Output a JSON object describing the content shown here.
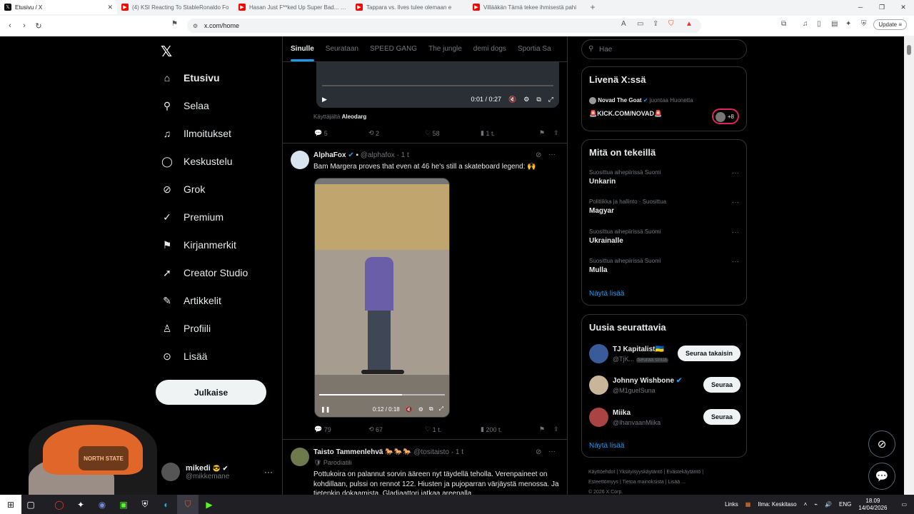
{
  "browser": {
    "tabs": [
      {
        "title": "Etusivu / X",
        "type": "x",
        "active": true
      },
      {
        "title": "(4) KSI Reacting To StableRonaldo Fo",
        "type": "yt"
      },
      {
        "title": "Hasan Just F**ked Up Super Bad... - Y",
        "type": "yt"
      },
      {
        "title": "Tappara vs. Ilves tulee olemaan e",
        "type": "yt"
      },
      {
        "title": "Villääkän Tämä tekee ihmisestä pahi",
        "type": "yt"
      }
    ],
    "new_tab": "+",
    "url": "x.com/home",
    "update_label": "Update"
  },
  "nav": {
    "logo": "X",
    "items": [
      {
        "label": "Etusivu",
        "icon": "home-icon",
        "glyph": "⌂"
      },
      {
        "label": "Selaa",
        "icon": "search-icon",
        "glyph": "⚲"
      },
      {
        "label": "Ilmoitukset",
        "icon": "bell-icon",
        "glyph": "♫"
      },
      {
        "label": "Keskustelu",
        "icon": "chat-icon",
        "glyph": "◯"
      },
      {
        "label": "Grok",
        "icon": "grok-icon",
        "glyph": "⊘"
      },
      {
        "label": "Premium",
        "icon": "premium-icon",
        "glyph": "✓"
      },
      {
        "label": "Kirjanmerkit",
        "icon": "bookmark-icon",
        "glyph": "⚑"
      },
      {
        "label": "Creator Studio",
        "icon": "rocket-icon",
        "glyph": "➚"
      },
      {
        "label": "Artikkelit",
        "icon": "article-icon",
        "glyph": "✎"
      },
      {
        "label": "Profiili",
        "icon": "profile-icon",
        "glyph": "♙"
      },
      {
        "label": "Lisää",
        "icon": "more-icon",
        "glyph": "⊙"
      }
    ],
    "post_label": "Julkaise",
    "account": {
      "name": "mikedi",
      "handle": "@mikkemane",
      "badges": "😎 ✔"
    },
    "account_more": "···"
  },
  "feed": {
    "tabs": [
      "Sinulle",
      "Seurataan",
      "SPEED GANG",
      "The jungle",
      "demi dogs",
      "Sportia Sa"
    ],
    "top_video": {
      "time": "0:01 / 0:27"
    },
    "top_credit_prefix": "Käyttäjältä",
    "top_credit_user": "Aleodarg",
    "top_actions": {
      "replies": "5",
      "reposts": "2",
      "likes": "58",
      "views": "1 t."
    },
    "tweets": [
      {
        "name": "AlphaFox",
        "handle": "@alphafox · 1 t",
        "text": "Bam Margera proves that even at 46 he's still a skateboard legend: 🙌",
        "video_time": "0:12 / 0:18",
        "video_progress": 0.66,
        "actions": {
          "replies": "79",
          "reposts": "67",
          "likes": "1 t.",
          "views": "200 t."
        }
      },
      {
        "name": "Taisto Tammenlehvä",
        "name_emoji": "🐎🐎🐎",
        "handle": "@tositaisto · 1 t",
        "tag": "🛡 Parodiatili",
        "text": "Pottukoira on palannut sorvin ääreen nyt täydellä teholla. Verenpaineet on kohdillaan, pulssi on rennot 122. Hiusten ja pujoparran värjäystä menossa. Ja tietenkin dokaamista. Gladiaattori jatkaa areenalla"
      }
    ]
  },
  "sidebar": {
    "search_placeholder": "Hae",
    "live": {
      "title": "Livenä X:ssä",
      "host": "Novad The Goat",
      "host_action": "juontaa Huonetta",
      "stream": "🚨KICK.COM/NOVAD🚨",
      "listeners": "+8"
    },
    "trends": {
      "title": "Mitä on tekeillä",
      "items": [
        {
          "context": "Suosittua aihepiirissä Suomi",
          "name": "Unkarin"
        },
        {
          "context": "Politiikka ja hallinto · Suosittua",
          "name": "Magyar"
        },
        {
          "context": "Suosittua aihepiirissä Suomi",
          "name": "Ukrainalle"
        },
        {
          "context": "Suosittua aihepiirissä Suomi",
          "name": "Mulla"
        }
      ],
      "more": "Näytä lisää",
      "item_more": "···"
    },
    "follow": {
      "title": "Uusia seurattavia",
      "items": [
        {
          "name": "TJ Kapitalist🇺🇦",
          "handle": "@TjK...",
          "follows_you": "Seuraa sinua",
          "button": "Seuraa takaisin"
        },
        {
          "name": "Johnny Wishbone",
          "handle": "@M1guelSuna",
          "button": "Seuraa"
        },
        {
          "name": "Miika",
          "handle": "@IhanvaanMiika",
          "button": "Seuraa"
        }
      ],
      "more": "Näytä lisää"
    },
    "footer": [
      "Käyttöehdot",
      "Yksityisyyskäytäntö",
      "Evästekäytäntö",
      "Esteettömyys",
      "Tietoa mainoksista",
      "Lisää ...",
      "© 2026 X Corp."
    ]
  },
  "taskbar": {
    "links": "Links",
    "weather": "Ilma: Keskitaso",
    "lang": "ENG",
    "time": "18.09",
    "date": "14/04/2026"
  },
  "colors": {
    "accent": "#1d9bf0",
    "bg": "#000000",
    "border": "#2f3336"
  }
}
